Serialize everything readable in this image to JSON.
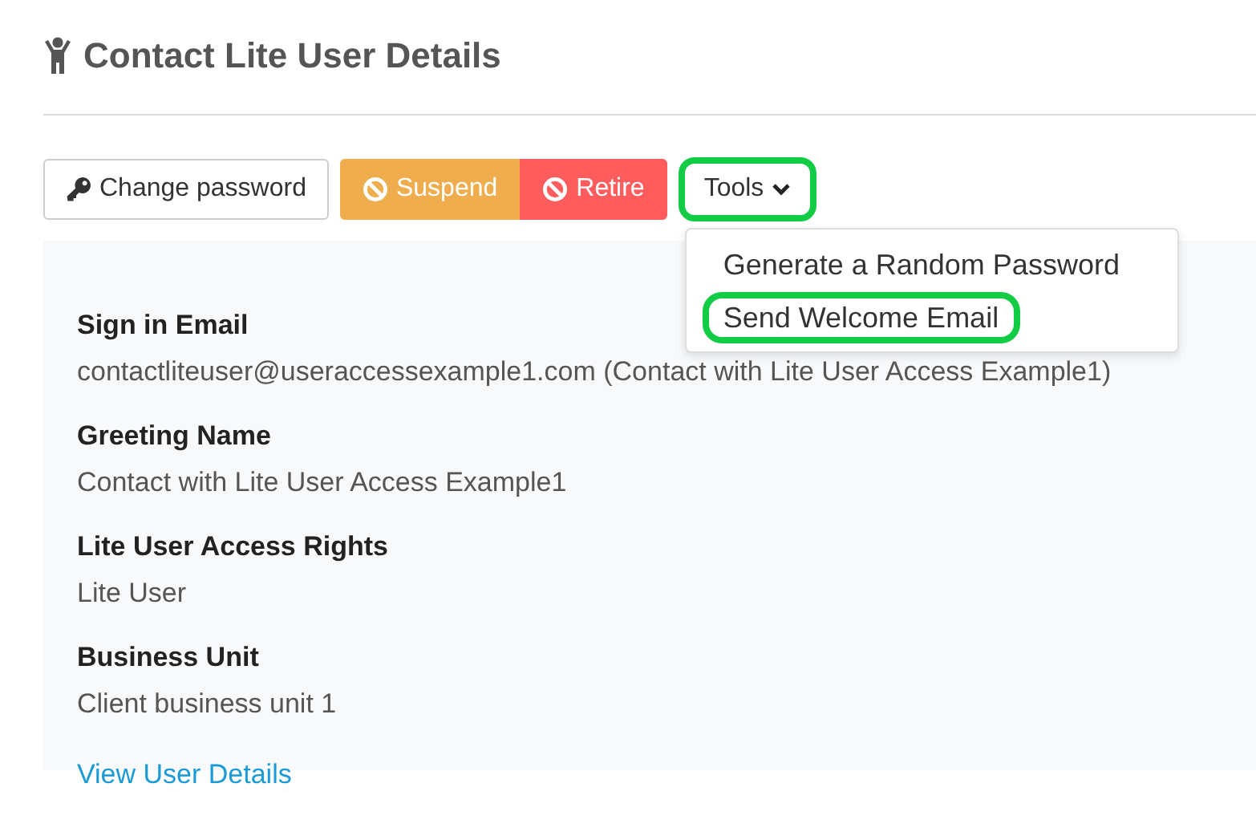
{
  "page": {
    "title": "Contact Lite User Details"
  },
  "actions": [
    {
      "label": "Change password",
      "kind": "key"
    },
    {
      "label": "Suspend",
      "kind": "warning"
    },
    {
      "label": "Retire",
      "kind": "danger"
    }
  ],
  "tools": {
    "label": "Tools",
    "expanded": true,
    "highlighted": true,
    "items": [
      {
        "label": "Generate a Random Password",
        "highlighted": false
      },
      {
        "label": "Send Welcome Email",
        "highlighted": true
      }
    ]
  },
  "fields": [
    {
      "label": "Sign in Email",
      "value": "contactliteuser@useraccessexample1.com (Contact with Lite User Access Example1)"
    },
    {
      "label": "Greeting Name",
      "value": "Contact with Lite User Access Example1"
    },
    {
      "label": "Lite User Access Rights",
      "value": "Lite User"
    },
    {
      "label": "Business Unit",
      "value": "Client business unit 1"
    }
  ],
  "link": "View User Details"
}
